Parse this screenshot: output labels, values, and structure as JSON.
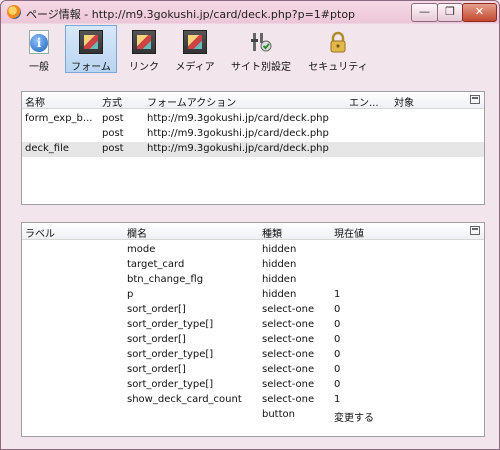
{
  "window": {
    "title": "ページ情報 - http://m9.3gokushi.jp/card/deck.php?p=1#ptop",
    "controls": {
      "minimize": "—",
      "maximize": "❐",
      "close": "✕"
    }
  },
  "toolbar": {
    "items": [
      {
        "label": "一般",
        "icon": "info-icon"
      },
      {
        "label": "フォーム",
        "icon": "form-icon",
        "active": true
      },
      {
        "label": "リンク",
        "icon": "link-icon"
      },
      {
        "label": "メディア",
        "icon": "media-icon"
      },
      {
        "label": "サイト別設定",
        "icon": "permissions-icon"
      },
      {
        "label": "セキュリティ",
        "icon": "lock-icon"
      }
    ]
  },
  "forms_table": {
    "headers": [
      "名称",
      "方式",
      "フォームアクション",
      "エン...",
      "対象"
    ],
    "rows": [
      {
        "name": "form_exp_b...",
        "method": "post",
        "action": "http://m9.3gokushi.jp/card/deck.php"
      },
      {
        "name": "",
        "method": "post",
        "action": "http://m9.3gokushi.jp/card/deck.php"
      },
      {
        "name": "deck_file",
        "method": "post",
        "action": "http://m9.3gokushi.jp/card/deck.php",
        "selected": true
      }
    ]
  },
  "fields_table": {
    "headers": [
      "ラベル",
      "欄名",
      "種類",
      "現在値"
    ],
    "rows": [
      {
        "label": "",
        "name": "mode",
        "type": "hidden",
        "value": ""
      },
      {
        "label": "",
        "name": "target_card",
        "type": "hidden",
        "value": ""
      },
      {
        "label": "",
        "name": "btn_change_flg",
        "type": "hidden",
        "value": ""
      },
      {
        "label": "",
        "name": "p",
        "type": "hidden",
        "value": "1"
      },
      {
        "label": "",
        "name": "sort_order[]",
        "type": "select-one",
        "value": "0"
      },
      {
        "label": "",
        "name": "sort_order_type[]",
        "type": "select-one",
        "value": "0"
      },
      {
        "label": "",
        "name": "sort_order[]",
        "type": "select-one",
        "value": "0"
      },
      {
        "label": "",
        "name": "sort_order_type[]",
        "type": "select-one",
        "value": "0"
      },
      {
        "label": "",
        "name": "sort_order[]",
        "type": "select-one",
        "value": "0"
      },
      {
        "label": "",
        "name": "sort_order_type[]",
        "type": "select-one",
        "value": "0"
      },
      {
        "label": "",
        "name": "show_deck_card_count",
        "type": "select-one",
        "value": "1"
      },
      {
        "label": "",
        "name": "",
        "type": "button",
        "value": "変更する"
      }
    ]
  }
}
